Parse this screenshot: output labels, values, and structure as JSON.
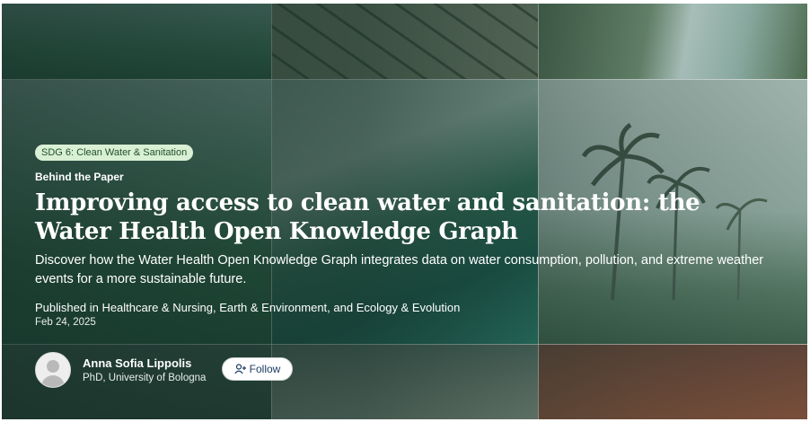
{
  "badge": "SDG 6: Clean Water & Sanitation",
  "kicker": "Behind the Paper",
  "title": "Improving access to clean water and sanitation: the Water Health Open Knowledge Graph",
  "description": "Discover how the Water Health Open Knowledge Graph integrates data on water consumption, pollution, and extreme weather events for a more sustainable future.",
  "published": "Published in Healthcare & Nursing, Earth & Environment, and Ecology & Evolution",
  "date": "Feb 24, 2025",
  "author": {
    "name": "Anna Sofia Lippolis",
    "affiliation": "PhD, University of Bologna"
  },
  "follow_label": "Follow",
  "colors": {
    "badge_bg": "#d9f0d4",
    "badge_text": "#1f4f2a",
    "follow_text": "#1b3d63",
    "overlay": "#142d26"
  }
}
